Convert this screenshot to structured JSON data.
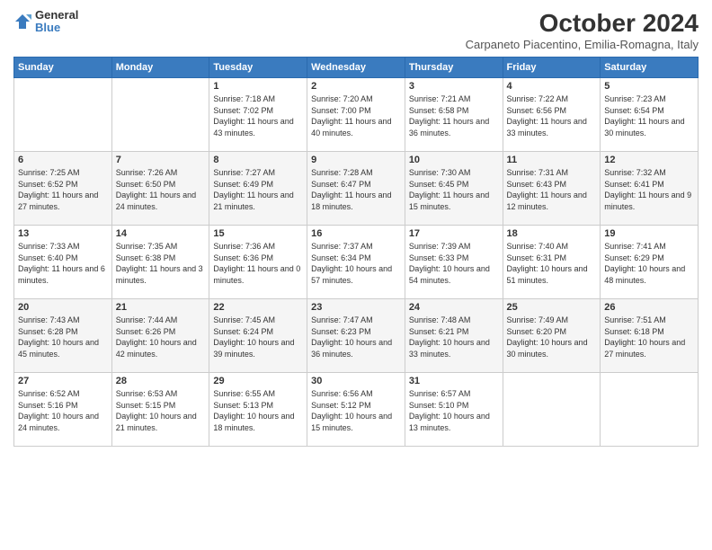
{
  "logo": {
    "line1": "General",
    "line2": "Blue"
  },
  "title": "October 2024",
  "subtitle": "Carpaneto Piacentino, Emilia-Romagna, Italy",
  "weekdays": [
    "Sunday",
    "Monday",
    "Tuesday",
    "Wednesday",
    "Thursday",
    "Friday",
    "Saturday"
  ],
  "weeks": [
    [
      {
        "day": "",
        "info": ""
      },
      {
        "day": "",
        "info": ""
      },
      {
        "day": "1",
        "info": "Sunrise: 7:18 AM\nSunset: 7:02 PM\nDaylight: 11 hours and 43 minutes."
      },
      {
        "day": "2",
        "info": "Sunrise: 7:20 AM\nSunset: 7:00 PM\nDaylight: 11 hours and 40 minutes."
      },
      {
        "day": "3",
        "info": "Sunrise: 7:21 AM\nSunset: 6:58 PM\nDaylight: 11 hours and 36 minutes."
      },
      {
        "day": "4",
        "info": "Sunrise: 7:22 AM\nSunset: 6:56 PM\nDaylight: 11 hours and 33 minutes."
      },
      {
        "day": "5",
        "info": "Sunrise: 7:23 AM\nSunset: 6:54 PM\nDaylight: 11 hours and 30 minutes."
      }
    ],
    [
      {
        "day": "6",
        "info": "Sunrise: 7:25 AM\nSunset: 6:52 PM\nDaylight: 11 hours and 27 minutes."
      },
      {
        "day": "7",
        "info": "Sunrise: 7:26 AM\nSunset: 6:50 PM\nDaylight: 11 hours and 24 minutes."
      },
      {
        "day": "8",
        "info": "Sunrise: 7:27 AM\nSunset: 6:49 PM\nDaylight: 11 hours and 21 minutes."
      },
      {
        "day": "9",
        "info": "Sunrise: 7:28 AM\nSunset: 6:47 PM\nDaylight: 11 hours and 18 minutes."
      },
      {
        "day": "10",
        "info": "Sunrise: 7:30 AM\nSunset: 6:45 PM\nDaylight: 11 hours and 15 minutes."
      },
      {
        "day": "11",
        "info": "Sunrise: 7:31 AM\nSunset: 6:43 PM\nDaylight: 11 hours and 12 minutes."
      },
      {
        "day": "12",
        "info": "Sunrise: 7:32 AM\nSunset: 6:41 PM\nDaylight: 11 hours and 9 minutes."
      }
    ],
    [
      {
        "day": "13",
        "info": "Sunrise: 7:33 AM\nSunset: 6:40 PM\nDaylight: 11 hours and 6 minutes."
      },
      {
        "day": "14",
        "info": "Sunrise: 7:35 AM\nSunset: 6:38 PM\nDaylight: 11 hours and 3 minutes."
      },
      {
        "day": "15",
        "info": "Sunrise: 7:36 AM\nSunset: 6:36 PM\nDaylight: 11 hours and 0 minutes."
      },
      {
        "day": "16",
        "info": "Sunrise: 7:37 AM\nSunset: 6:34 PM\nDaylight: 10 hours and 57 minutes."
      },
      {
        "day": "17",
        "info": "Sunrise: 7:39 AM\nSunset: 6:33 PM\nDaylight: 10 hours and 54 minutes."
      },
      {
        "day": "18",
        "info": "Sunrise: 7:40 AM\nSunset: 6:31 PM\nDaylight: 10 hours and 51 minutes."
      },
      {
        "day": "19",
        "info": "Sunrise: 7:41 AM\nSunset: 6:29 PM\nDaylight: 10 hours and 48 minutes."
      }
    ],
    [
      {
        "day": "20",
        "info": "Sunrise: 7:43 AM\nSunset: 6:28 PM\nDaylight: 10 hours and 45 minutes."
      },
      {
        "day": "21",
        "info": "Sunrise: 7:44 AM\nSunset: 6:26 PM\nDaylight: 10 hours and 42 minutes."
      },
      {
        "day": "22",
        "info": "Sunrise: 7:45 AM\nSunset: 6:24 PM\nDaylight: 10 hours and 39 minutes."
      },
      {
        "day": "23",
        "info": "Sunrise: 7:47 AM\nSunset: 6:23 PM\nDaylight: 10 hours and 36 minutes."
      },
      {
        "day": "24",
        "info": "Sunrise: 7:48 AM\nSunset: 6:21 PM\nDaylight: 10 hours and 33 minutes."
      },
      {
        "day": "25",
        "info": "Sunrise: 7:49 AM\nSunset: 6:20 PM\nDaylight: 10 hours and 30 minutes."
      },
      {
        "day": "26",
        "info": "Sunrise: 7:51 AM\nSunset: 6:18 PM\nDaylight: 10 hours and 27 minutes."
      }
    ],
    [
      {
        "day": "27",
        "info": "Sunrise: 6:52 AM\nSunset: 5:16 PM\nDaylight: 10 hours and 24 minutes."
      },
      {
        "day": "28",
        "info": "Sunrise: 6:53 AM\nSunset: 5:15 PM\nDaylight: 10 hours and 21 minutes."
      },
      {
        "day": "29",
        "info": "Sunrise: 6:55 AM\nSunset: 5:13 PM\nDaylight: 10 hours and 18 minutes."
      },
      {
        "day": "30",
        "info": "Sunrise: 6:56 AM\nSunset: 5:12 PM\nDaylight: 10 hours and 15 minutes."
      },
      {
        "day": "31",
        "info": "Sunrise: 6:57 AM\nSunset: 5:10 PM\nDaylight: 10 hours and 13 minutes."
      },
      {
        "day": "",
        "info": ""
      },
      {
        "day": "",
        "info": ""
      }
    ]
  ]
}
